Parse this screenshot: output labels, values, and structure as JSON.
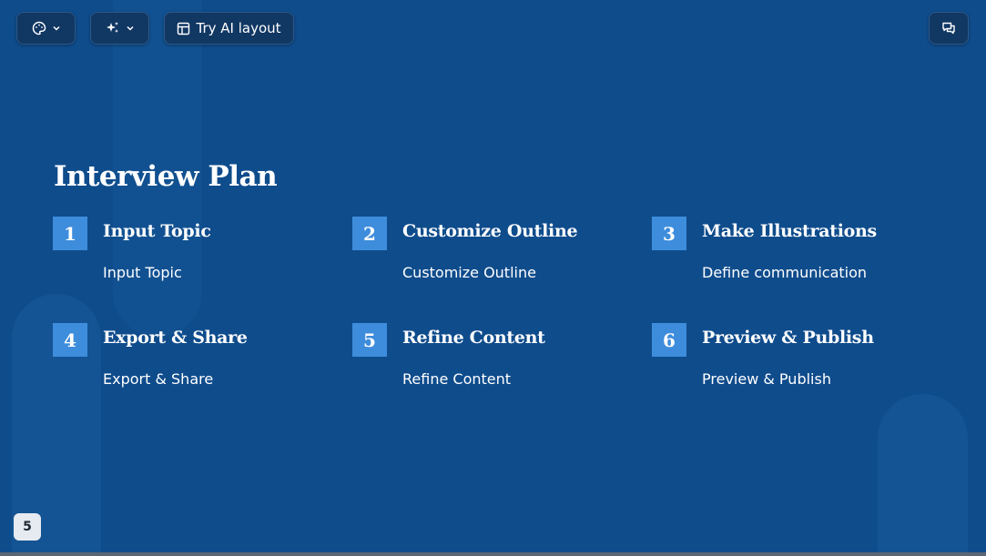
{
  "toolbar": {
    "theme_icon": "palette-icon",
    "ai_icon": "sparkles-icon",
    "layout_icon": "layout-icon",
    "layout_label": "Try AI layout",
    "comments_icon": "comments-icon"
  },
  "slide": {
    "title": "Interview Plan",
    "steps": [
      {
        "number": "1",
        "title": "Input Topic",
        "description": "Input Topic"
      },
      {
        "number": "2",
        "title": "Customize Outline",
        "description": "Customize Outline"
      },
      {
        "number": "3",
        "title": "Make Illustrations",
        "description": "Define communication"
      },
      {
        "number": "4",
        "title": "Export & Share",
        "description": "Export & Share"
      },
      {
        "number": "5",
        "title": "Refine Content",
        "description": "Refine Content"
      },
      {
        "number": "6",
        "title": "Preview & Publish",
        "description": "Preview & Publish"
      }
    ],
    "page_number": "5"
  },
  "colors": {
    "background": "#0f4c8c",
    "accent": "#3e8ddc",
    "toolbar_button": "#113763"
  }
}
